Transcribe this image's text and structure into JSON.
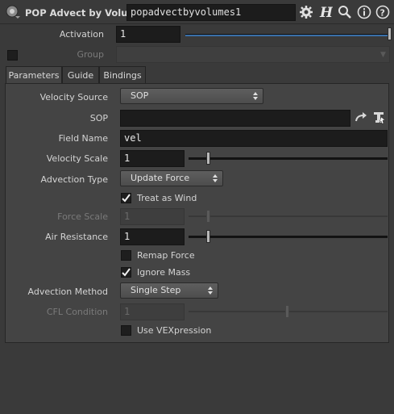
{
  "header": {
    "node_type": "POP Advect by Volumes",
    "node_name": "popadvectbyvolumes1",
    "icons": [
      "node-type-icon",
      "gear-icon",
      "help-h-icon",
      "search-icon",
      "info-icon",
      "help-icon"
    ]
  },
  "activation": {
    "label": "Activation",
    "value": "1",
    "slider_fraction": 1.0
  },
  "group": {
    "label": "Group",
    "value": "",
    "enabled": false
  },
  "tabs": [
    {
      "label": "Parameters",
      "active": true
    },
    {
      "label": "Guide",
      "active": false
    },
    {
      "label": "Bindings",
      "active": false
    }
  ],
  "params": {
    "velocity_source": {
      "label": "Velocity Source",
      "value": "SOP"
    },
    "sop": {
      "label": "SOP",
      "value": ""
    },
    "field_name": {
      "label": "Field Name",
      "value": "vel"
    },
    "velocity_scale": {
      "label": "Velocity Scale",
      "value": "1",
      "slider_fraction": 0.1
    },
    "advection_type": {
      "label": "Advection Type",
      "value": "Update Force"
    },
    "treat_as_wind": {
      "label": "Treat as Wind",
      "checked": true
    },
    "force_scale": {
      "label": "Force Scale",
      "value": "1",
      "enabled": false,
      "slider_fraction": 0.1
    },
    "air_resistance": {
      "label": "Air Resistance",
      "value": "1",
      "slider_fraction": 0.1
    },
    "remap_force": {
      "label": "Remap Force",
      "checked": false
    },
    "ignore_mass": {
      "label": "Ignore Mass",
      "checked": true
    },
    "advection_method": {
      "label": "Advection Method",
      "value": "Single Step"
    },
    "cfl_condition": {
      "label": "CFL Condition",
      "value": "1",
      "enabled": false,
      "slider_fraction": 0.5
    },
    "use_vexpression": {
      "label": "Use VEXpression",
      "checked": false
    }
  },
  "colors": {
    "background": "#3a3a3a",
    "panel": "#444444",
    "field": "#1c1c1c",
    "accent_blue": "#3a6fa8"
  }
}
